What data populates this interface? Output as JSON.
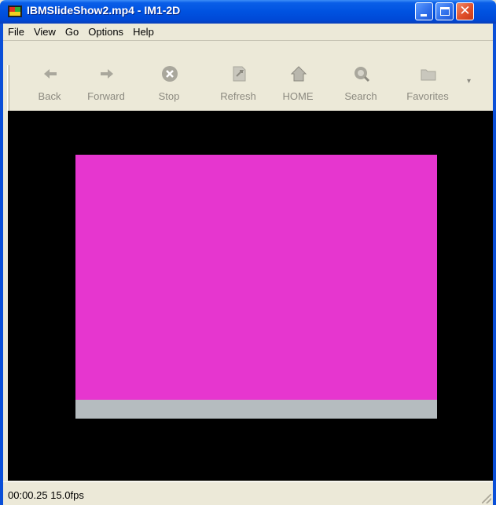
{
  "window": {
    "title": "IBMSlideShow2.mp4 - IM1-2D"
  },
  "menu": {
    "items": [
      "File",
      "View",
      "Go",
      "Options",
      "Help"
    ]
  },
  "toolbar": {
    "buttons": [
      {
        "label": "Back",
        "icon": "back-arrow-icon"
      },
      {
        "label": "Forward",
        "icon": "forward-arrow-icon"
      },
      {
        "label": "Stop",
        "icon": "stop-icon"
      },
      {
        "label": "Refresh",
        "icon": "refresh-icon"
      },
      {
        "label": "HOME",
        "icon": "home-icon"
      },
      {
        "label": "Search",
        "icon": "search-icon"
      },
      {
        "label": "Favorites",
        "icon": "favorites-folder-icon"
      }
    ]
  },
  "video": {
    "slide_color": "#e636cf",
    "bar_color": "#b5bcbf",
    "background": "#000000"
  },
  "status": {
    "text": "00:00.25 15.0fps"
  }
}
